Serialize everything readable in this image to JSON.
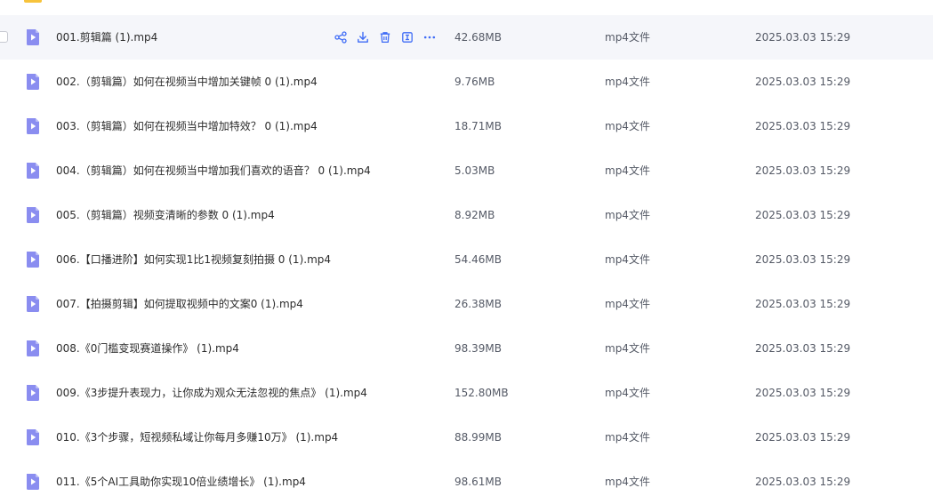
{
  "accent_color": "#3f6cf6",
  "file_icon_color": "#8a8df0",
  "hover_actions": [
    "share-icon",
    "download-icon",
    "delete-icon",
    "preview-icon",
    "more-icon"
  ],
  "files": [
    {
      "name": "001.剪辑篇 (1).mp4",
      "size": "42.68MB",
      "type": "mp4文件",
      "time": "2025.03.03 15:29"
    },
    {
      "name": "002.（剪辑篇）如何在视频当中增加关键帧 0 (1).mp4",
      "size": "9.76MB",
      "type": "mp4文件",
      "time": "2025.03.03 15:29"
    },
    {
      "name": "003.（剪辑篇）如何在视频当中增加特效？ 0 (1).mp4",
      "size": "18.71MB",
      "type": "mp4文件",
      "time": "2025.03.03 15:29"
    },
    {
      "name": "004.（剪辑篇）如何在视频当中增加我们喜欢的语音？ 0 (1).mp4",
      "size": "5.03MB",
      "type": "mp4文件",
      "time": "2025.03.03 15:29"
    },
    {
      "name": "005.（剪辑篇）视频变清晰的参数 0 (1).mp4",
      "size": "8.92MB",
      "type": "mp4文件",
      "time": "2025.03.03 15:29"
    },
    {
      "name": "006.【口播进阶】如何实现1比1视频复刻拍摄 0 (1).mp4",
      "size": "54.46MB",
      "type": "mp4文件",
      "time": "2025.03.03 15:29"
    },
    {
      "name": "007.【拍摄剪辑】如何提取视频中的文案0 (1).mp4",
      "size": "26.38MB",
      "type": "mp4文件",
      "time": "2025.03.03 15:29"
    },
    {
      "name": "008.《0门槛变现赛道操作》 (1).mp4",
      "size": "98.39MB",
      "type": "mp4文件",
      "time": "2025.03.03 15:29"
    },
    {
      "name": "009.《3步提升表现力，让你成为观众无法忽视的焦点》 (1).mp4",
      "size": "152.80MB",
      "type": "mp4文件",
      "time": "2025.03.03 15:29"
    },
    {
      "name": "010.《3个步骤，短视频私域让你每月多赚10万》 (1).mp4",
      "size": "88.99MB",
      "type": "mp4文件",
      "time": "2025.03.03 15:29"
    },
    {
      "name": "011.《5个AI工具助你实现10倍业绩增长》 (1).mp4",
      "size": "98.61MB",
      "type": "mp4文件",
      "time": "2025.03.03 15:29"
    }
  ]
}
